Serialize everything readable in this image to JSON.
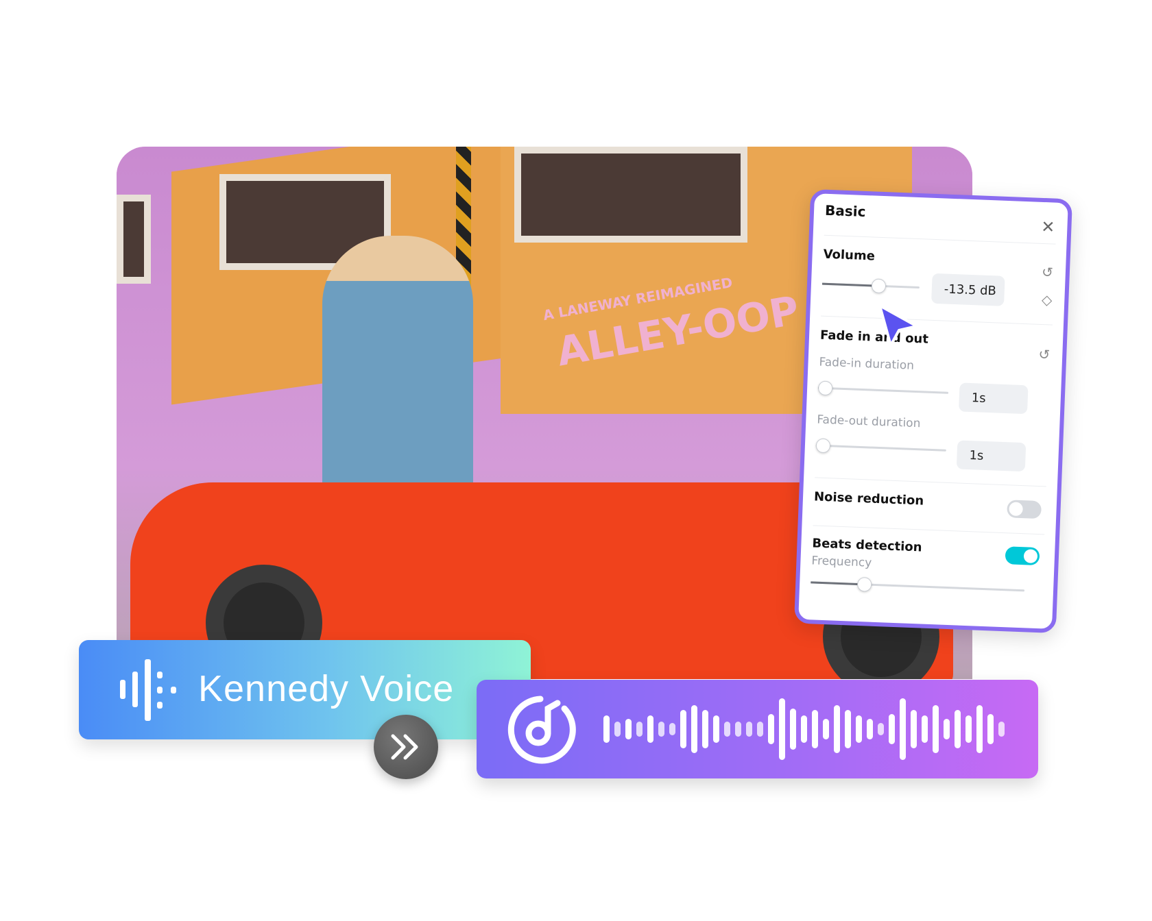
{
  "panel": {
    "title": "Basic",
    "volume": {
      "label": "Volume",
      "value": "-13.5 dB",
      "level": 0.58
    },
    "fade": {
      "label": "Fade in and out",
      "fade_in": {
        "label": "Fade-in duration",
        "value": "1s",
        "level": 0.05
      },
      "fade_out": {
        "label": "Fade-out duration",
        "value": "1s",
        "level": 0.05
      }
    },
    "noise": {
      "label": "Noise reduction",
      "on": false
    },
    "beats": {
      "label": "Beats detection",
      "on": true,
      "frequency_label": "Frequency",
      "frequency_level": 0.25
    },
    "accent": "#8a6cf0",
    "toggle_on": "#00c8d8"
  },
  "voice": {
    "name": "Kennedy Voice",
    "icon": "voice-waveform-icon"
  },
  "audio": {
    "icon": "music-note-icon"
  },
  "convert": {
    "icon": "double-chevron-right-icon"
  },
  "photo": {
    "sign_text": "ALLEY-OOP",
    "sign_sub": "A LANEWAY REIMAGINED"
  }
}
